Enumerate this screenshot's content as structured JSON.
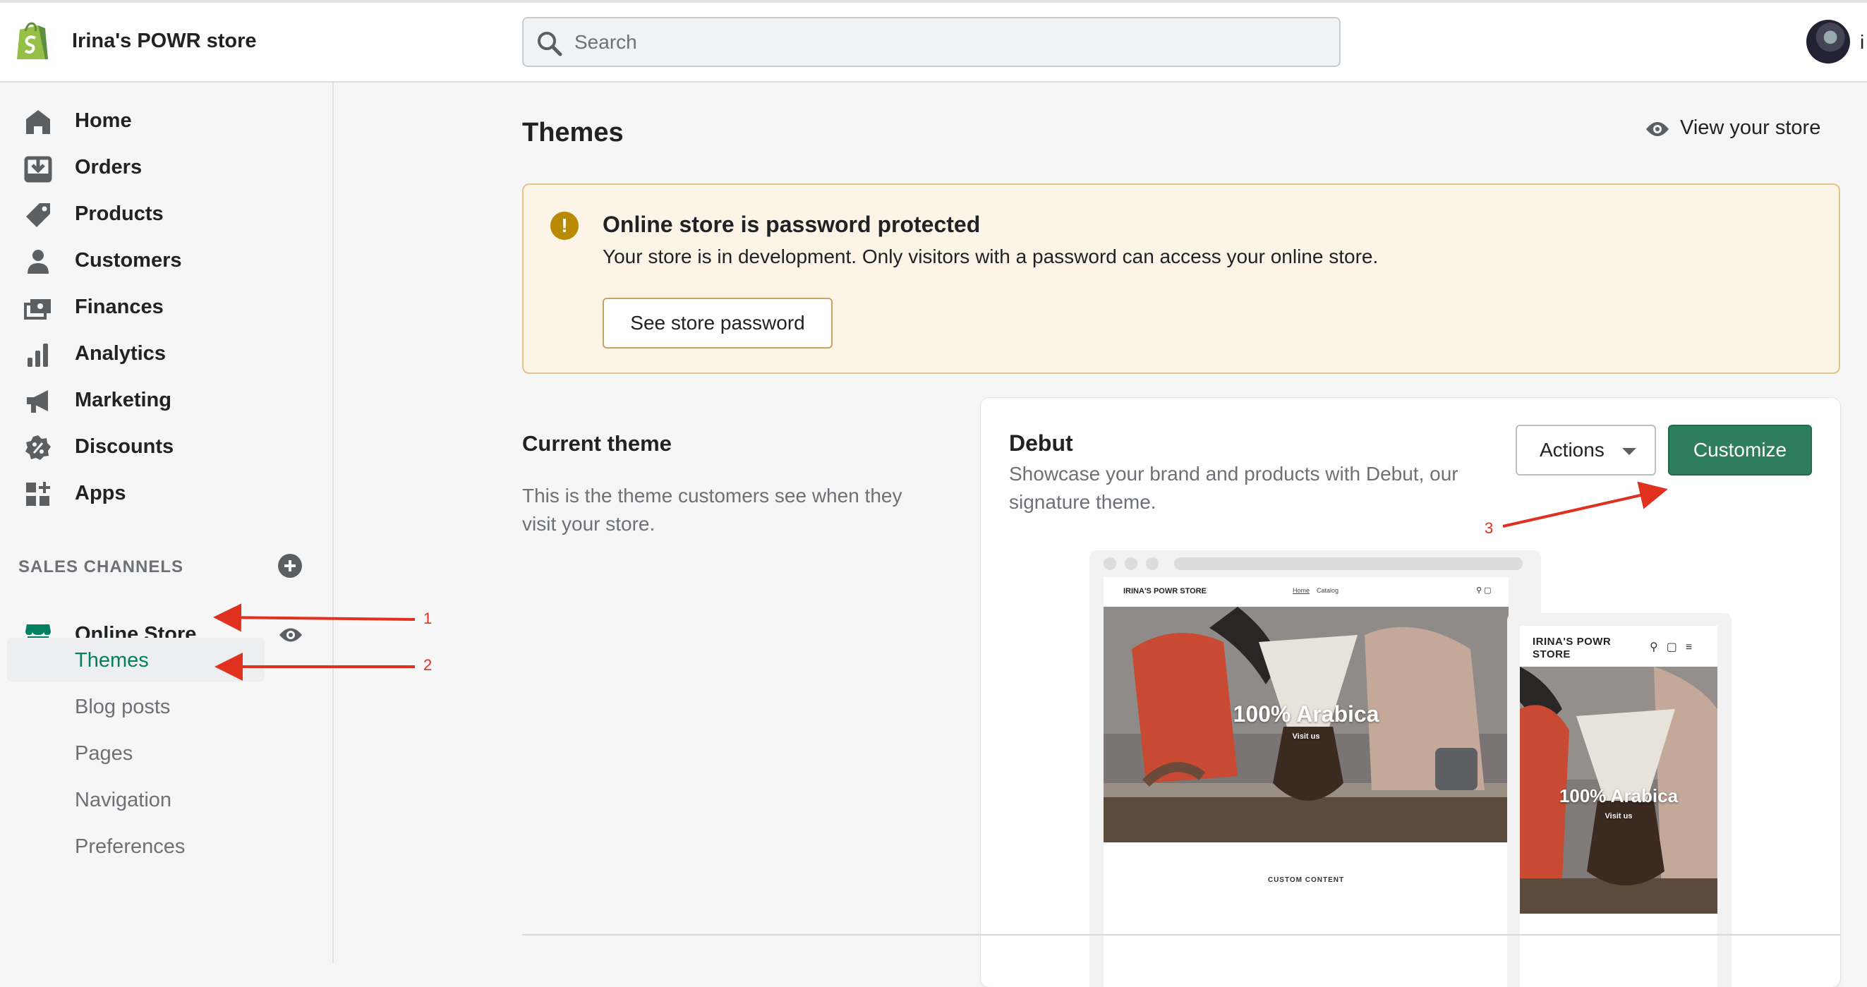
{
  "header": {
    "store_name": "Irina's POWR store",
    "search_placeholder": "Search",
    "avatar_overflow": "i"
  },
  "sidebar": {
    "items": [
      {
        "label": "Home",
        "icon": "home-icon"
      },
      {
        "label": "Orders",
        "icon": "orders-icon"
      },
      {
        "label": "Products",
        "icon": "tag-icon"
      },
      {
        "label": "Customers",
        "icon": "person-icon"
      },
      {
        "label": "Finances",
        "icon": "finances-icon"
      },
      {
        "label": "Analytics",
        "icon": "bar-chart-icon"
      },
      {
        "label": "Marketing",
        "icon": "megaphone-icon"
      },
      {
        "label": "Discounts",
        "icon": "discount-icon"
      },
      {
        "label": "Apps",
        "icon": "apps-icon"
      }
    ],
    "sales_channels_heading": "SALES CHANNELS",
    "channel": {
      "label": "Online Store",
      "icon": "store-icon"
    },
    "sub_items": [
      {
        "label": "Themes",
        "active": true
      },
      {
        "label": "Blog posts"
      },
      {
        "label": "Pages"
      },
      {
        "label": "Navigation"
      },
      {
        "label": "Preferences"
      }
    ]
  },
  "main": {
    "title": "Themes",
    "view_store_label": "View your store",
    "banner": {
      "title": "Online store is password protected",
      "text": "Your store is in development. Only visitors with a password can access your online store.",
      "button": "See store password"
    },
    "current_theme": {
      "heading": "Current theme",
      "description": "This is the theme customers see when they visit your store."
    },
    "theme_card": {
      "name": "Debut",
      "description": "Showcase your brand and products with Debut, our signature theme.",
      "actions_label": "Actions",
      "customize_label": "Customize",
      "preview": {
        "brand": "IRINA'S POWR STORE",
        "nav_home": "Home",
        "nav_catalog": "Catalog",
        "mobile_brand": "IRINA'S POWR STORE",
        "hero_title": "100% Arabica",
        "hero_link": "Visit us",
        "custom_content": "CUSTOM CONTENT"
      }
    }
  },
  "annotations": {
    "arrow_1": "1",
    "arrow_2": "2",
    "arrow_3": "3"
  },
  "colors": {
    "accent_green": "#2e7d5b",
    "banner_bg": "#fdf4e8",
    "warning": "#b98900",
    "annotation_red": "#e0301e"
  }
}
